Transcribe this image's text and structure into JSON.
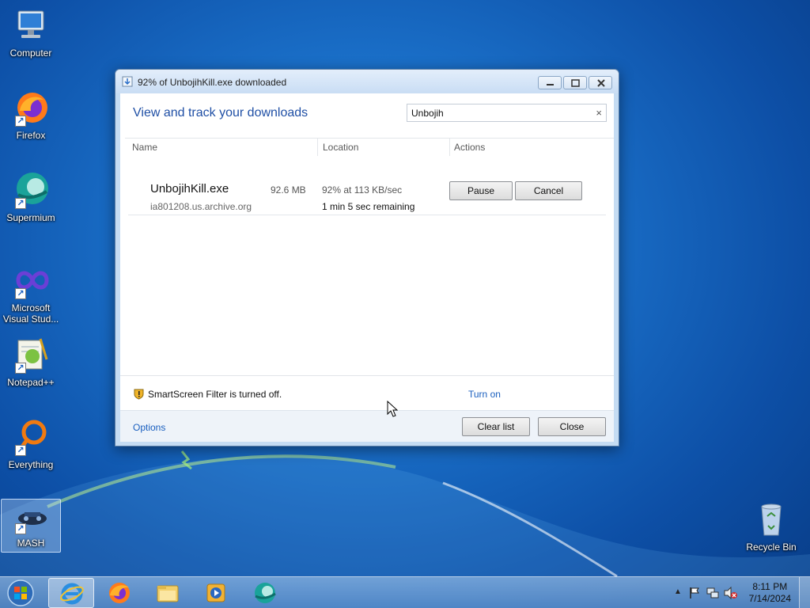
{
  "desktop": {
    "icons": [
      {
        "label": "Computer"
      },
      {
        "label": "Firefox"
      },
      {
        "label": "Supermium"
      },
      {
        "label": "Microsoft Visual Stud..."
      },
      {
        "label": "Notepad++"
      },
      {
        "label": "Everything"
      },
      {
        "label": "MASH"
      },
      {
        "label": "Recycle Bin"
      }
    ]
  },
  "window": {
    "title": "92% of UnbojihKill.exe downloaded",
    "header": "View and track your downloads",
    "search": {
      "value": "Unbojih",
      "clear_glyph": "×"
    },
    "columns": {
      "name": "Name",
      "location": "Location",
      "actions": "Actions"
    },
    "download": {
      "filename": "UnbojihKill.exe",
      "size": "92.6 MB",
      "host": "ia801208.us.archive.org",
      "progress_text": "92% at 113 KB/sec",
      "remaining": "1 min 5 sec remaining",
      "percent": 92,
      "pause_label": "Pause",
      "cancel_label": "Cancel"
    },
    "smartscreen": {
      "text": "SmartScreen Filter is turned off.",
      "link": "Turn on"
    },
    "footer": {
      "options": "Options",
      "clear_list": "Clear list",
      "close": "Close"
    }
  },
  "taskbar": {
    "apps": [
      {
        "icon": "internet-explorer-icon",
        "active": true
      },
      {
        "icon": "firefox-icon",
        "active": false
      },
      {
        "icon": "file-explorer-icon",
        "active": false
      },
      {
        "icon": "media-player-icon",
        "active": false
      },
      {
        "icon": "supermium-icon",
        "active": false
      }
    ],
    "clock": {
      "time": "8:11 PM",
      "date": "7/14/2024"
    }
  },
  "colors": {
    "accent": "#1a5fbf",
    "header_text": "#1f4fa5"
  }
}
